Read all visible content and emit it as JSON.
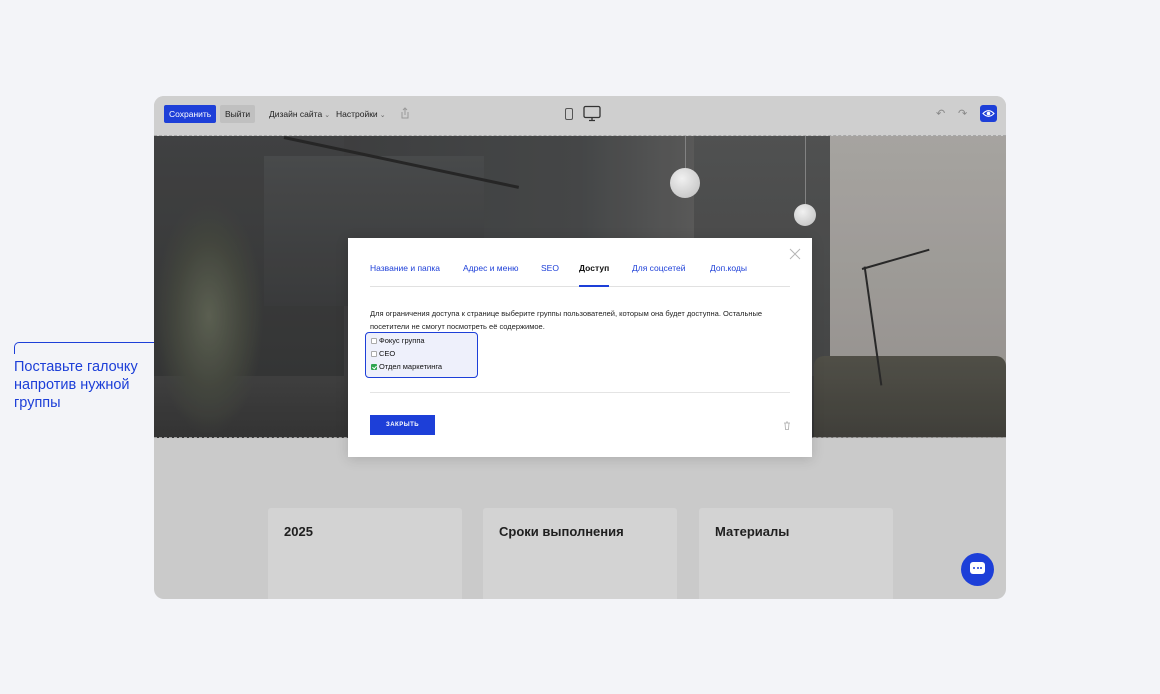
{
  "annotation": {
    "text": "Поставьте галочку напротив нужной группы"
  },
  "toolbar": {
    "save_label": "Сохранить",
    "exit_label": "Выйти",
    "design_menu_label": "Дизайн сайта",
    "settings_menu_label": "Настройки",
    "icons": [
      "share-icon",
      "phone-view-icon",
      "desktop-view-icon",
      "undo-icon",
      "redo-icon",
      "eye-icon"
    ]
  },
  "modal": {
    "tabs": [
      {
        "label": "Название и папка",
        "active": false
      },
      {
        "label": "Адрес и меню",
        "active": false
      },
      {
        "label": "SEO",
        "active": false
      },
      {
        "label": "Доступ",
        "active": true
      },
      {
        "label": "Для соцсетей",
        "active": false
      },
      {
        "label": "Доп.коды",
        "active": false
      }
    ],
    "description": "Для ограничения доступа к странице выберите группы пользователей, которым она будет доступна. Остальные посетители не смогут посмотреть её содержимое.",
    "groups": [
      {
        "label": "Фокус группа",
        "checked": false
      },
      {
        "label": "CEO",
        "checked": false
      },
      {
        "label": "Отдел маркетинга",
        "checked": true
      }
    ],
    "close_button_label": "ЗАКРЫТЬ"
  },
  "cards": [
    {
      "title": "2025"
    },
    {
      "title": "Сроки выполнения"
    },
    {
      "title": "Материалы"
    }
  ],
  "colors": {
    "accent": "#1d3fd8",
    "checked": "#2ea44f"
  }
}
